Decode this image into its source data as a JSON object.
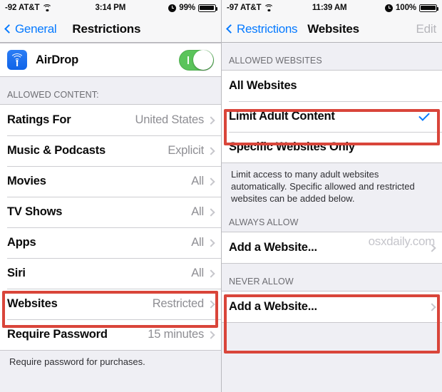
{
  "left": {
    "status": {
      "carrier": "-92 AT&T",
      "time": "3:14 PM",
      "battery": "99%",
      "wifi_icon": "wifi-icon",
      "alarm_icon": "alarm-clock-icon",
      "battery_icon": "battery-icon"
    },
    "nav": {
      "back": "General",
      "title": "Restrictions"
    },
    "airdrop": {
      "label": "AirDrop",
      "icon": "airdrop-icon",
      "toggle_state": "on"
    },
    "section_header": "ALLOWED CONTENT:",
    "rows": [
      {
        "label": "Ratings For",
        "value": "United States"
      },
      {
        "label": "Music & Podcasts",
        "value": "Explicit"
      },
      {
        "label": "Movies",
        "value": "All"
      },
      {
        "label": "TV Shows",
        "value": "All"
      },
      {
        "label": "Apps",
        "value": "All"
      },
      {
        "label": "Siri",
        "value": "All"
      },
      {
        "label": "Websites",
        "value": "Restricted"
      },
      {
        "label": "Require Password",
        "value": "15 minutes"
      }
    ],
    "footer": "Require password for purchases."
  },
  "right": {
    "status": {
      "carrier": "-97 AT&T",
      "time": "11:39 AM",
      "battery": "100%",
      "wifi_icon": "wifi-icon",
      "alarm_icon": "alarm-clock-icon",
      "battery_icon": "battery-icon"
    },
    "nav": {
      "back": "Restrictions",
      "title": "Websites",
      "edit": "Edit"
    },
    "allowed_header": "ALLOWED WEBSITES",
    "allowed_rows": [
      {
        "label": "All Websites",
        "checked": false
      },
      {
        "label": "Limit Adult Content",
        "checked": true
      },
      {
        "label": "Specific Websites Only",
        "checked": false
      }
    ],
    "footer": "Limit access to many adult websites automatically. Specific allowed and restricted websites can be added below.",
    "always_allow_header": "ALWAYS ALLOW",
    "always_allow_row": "Add a Website...",
    "never_allow_header": "NEVER ALLOW",
    "never_allow_row": "Add a Website...",
    "watermark": "osxdaily.com"
  },
  "colors": {
    "accent": "#067aff",
    "highlight": "#d9453a",
    "toggle_on": "#5bc45b",
    "value_gray": "#8e8e93"
  }
}
